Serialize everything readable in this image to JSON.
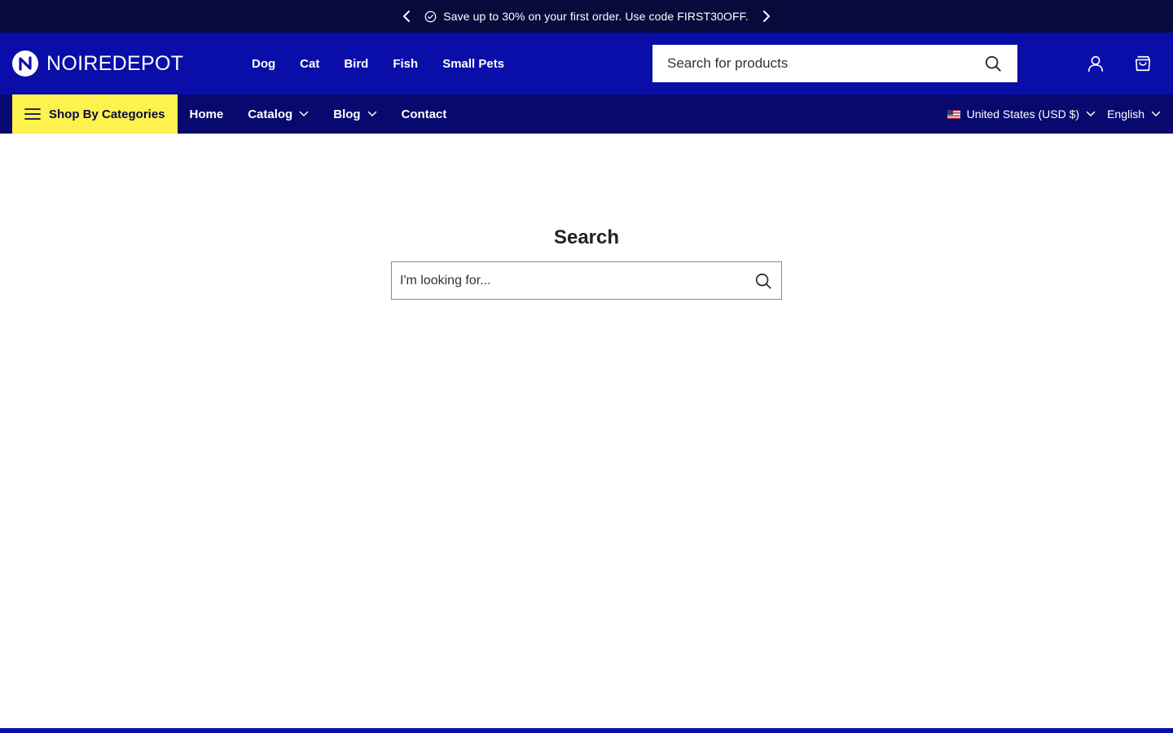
{
  "announcement": {
    "text": "Save up to 30% on your first order. Use code FIRST30OFF.",
    "icon": "check-badge-icon"
  },
  "header": {
    "logo_text": "NOIREDEPOT",
    "nav": [
      {
        "label": "Dog"
      },
      {
        "label": "Cat"
      },
      {
        "label": "Bird"
      },
      {
        "label": "Fish"
      },
      {
        "label": "Small Pets"
      }
    ],
    "search_placeholder": "Search for products",
    "icons": [
      "account-icon",
      "cart-icon"
    ]
  },
  "subnav": {
    "shop_categories": "Shop By Categories",
    "menu": [
      {
        "label": "Home"
      },
      {
        "label": "Catalog"
      },
      {
        "label": "Blog"
      },
      {
        "label": "Contact"
      }
    ],
    "country": "United States (USD $)",
    "language": "English"
  },
  "main": {
    "title": "Search",
    "search_placeholder": "I'm looking for..."
  },
  "colors": {
    "announcement_bg": "#080a3b",
    "header_bg": "#0a0ea8",
    "subnav_bg": "#07096e",
    "accent_yellow": "#fef24e"
  }
}
